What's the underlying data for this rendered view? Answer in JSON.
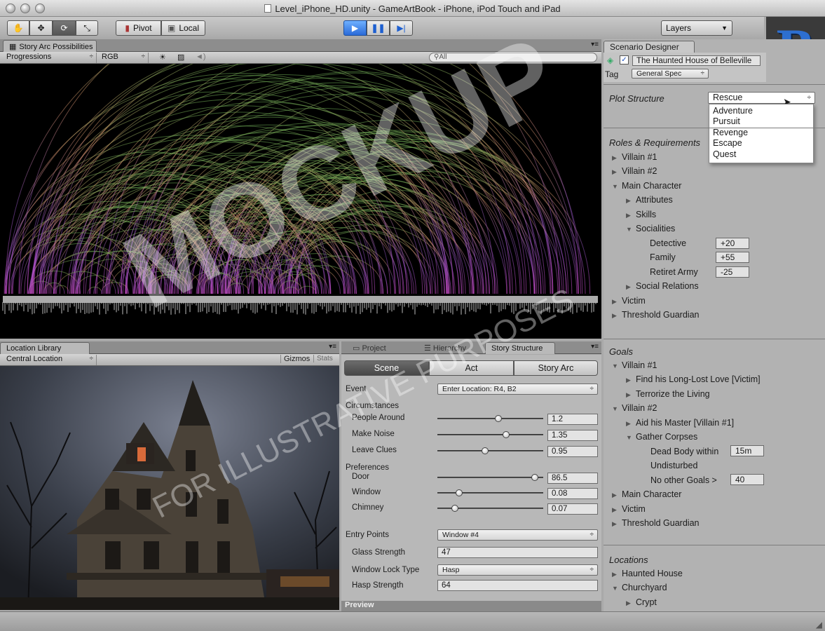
{
  "window": {
    "title": "Level_iPhone_HD.unity - GameArtBook - iPhone, iPod Touch and iPad"
  },
  "toolbar": {
    "pivot": "Pivot",
    "local": "Local",
    "layers": "Layers"
  },
  "logo": {
    "letter": "B"
  },
  "story_arc": {
    "tab": "Story Arc Possibilities",
    "progression_select": "Progressions",
    "color_select": "RGB",
    "search_placeholder": "All"
  },
  "location_library": {
    "tab": "Location Library",
    "location_select": "Central Location",
    "gizmos": "Gizmos",
    "stats": "Stats"
  },
  "bottom_tabs": {
    "project": "Project",
    "hierarchy": "Hierarchy",
    "story_structure": "Story Structure"
  },
  "story_structure": {
    "segments": [
      "Scene",
      "Act",
      "Story Arc"
    ],
    "event_label": "Event",
    "event_value": "Enter Location: R4, B2",
    "circumstances_label": "Circumstances",
    "circumstances": [
      {
        "label": "People Around",
        "value": "1.2",
        "level": 0.56
      },
      {
        "label": "Make Noise",
        "value": "1.35",
        "level": 0.64
      },
      {
        "label": "Leave Clues",
        "value": "0.95",
        "level": 0.43
      }
    ],
    "preferences_label": "Preferences",
    "preferences": [
      {
        "label": "Door",
        "value": "86.5",
        "level": 0.92
      },
      {
        "label": "Window",
        "value": "0.08",
        "level": 0.18
      },
      {
        "label": "Chimney",
        "value": "0.07",
        "level": 0.14
      }
    ],
    "entry_points_label": "Entry Points",
    "entry_points_value": "Window #4",
    "glass_strength_label": "Glass Strength",
    "glass_strength_value": "47",
    "window_lock_label": "Window Lock Type",
    "window_lock_value": "Hasp",
    "hasp_strength_label": "Hasp Strength",
    "hasp_strength_value": "64",
    "preview": "Preview"
  },
  "scenario": {
    "tab": "Scenario Designer",
    "name": "The Haunted House of Belleville",
    "tag_label": "Tag",
    "tag_value": "General Spec",
    "plot_label": "Plot Structure",
    "plot_value": "Rescue",
    "plot_options": [
      "Adventure",
      "Pursuit",
      "Revenge",
      "Escape",
      "Quest"
    ]
  },
  "roles": {
    "title": "Roles & Requirements",
    "villain1": "Villain #1",
    "villain2": "Villain #2",
    "main_character": "Main Character",
    "attributes": "Attributes",
    "skills": "Skills",
    "socialities": "Socialities",
    "detective": "Detective",
    "detective_val": "+20",
    "family": "Family",
    "family_val": "+55",
    "retiret_army": "Retiret Army",
    "retiret_army_val": "-25",
    "social_relations": "Social Relations",
    "victim": "Victim",
    "threshold_guardian": "Threshold Guardian"
  },
  "goals": {
    "title": "Goals",
    "villain1": "Villain #1",
    "g1": "Find his Long-Lost Love [Victim]",
    "g2": "Terrorize the Living",
    "villain2": "Villain #2",
    "g3": "Aid his Master [Villain #1]",
    "g4": "Gather Corpses",
    "dead_body": "Dead Body within",
    "dead_body_val": "15m",
    "undisturbed": "Undisturbed",
    "no_other_goals": "No other Goals >",
    "no_other_goals_val": "40",
    "main_character": "Main Character",
    "victim": "Victim",
    "threshold_guardian": "Threshold Guardian"
  },
  "locations": {
    "title": "Locations",
    "haunted_house": "Haunted House",
    "churchyard": "Churchyard",
    "crypt": "Crypt"
  },
  "watermark": {
    "big": "MOCKUP",
    "small": "FOR ILLUSTRATIVE PURPOSES"
  }
}
